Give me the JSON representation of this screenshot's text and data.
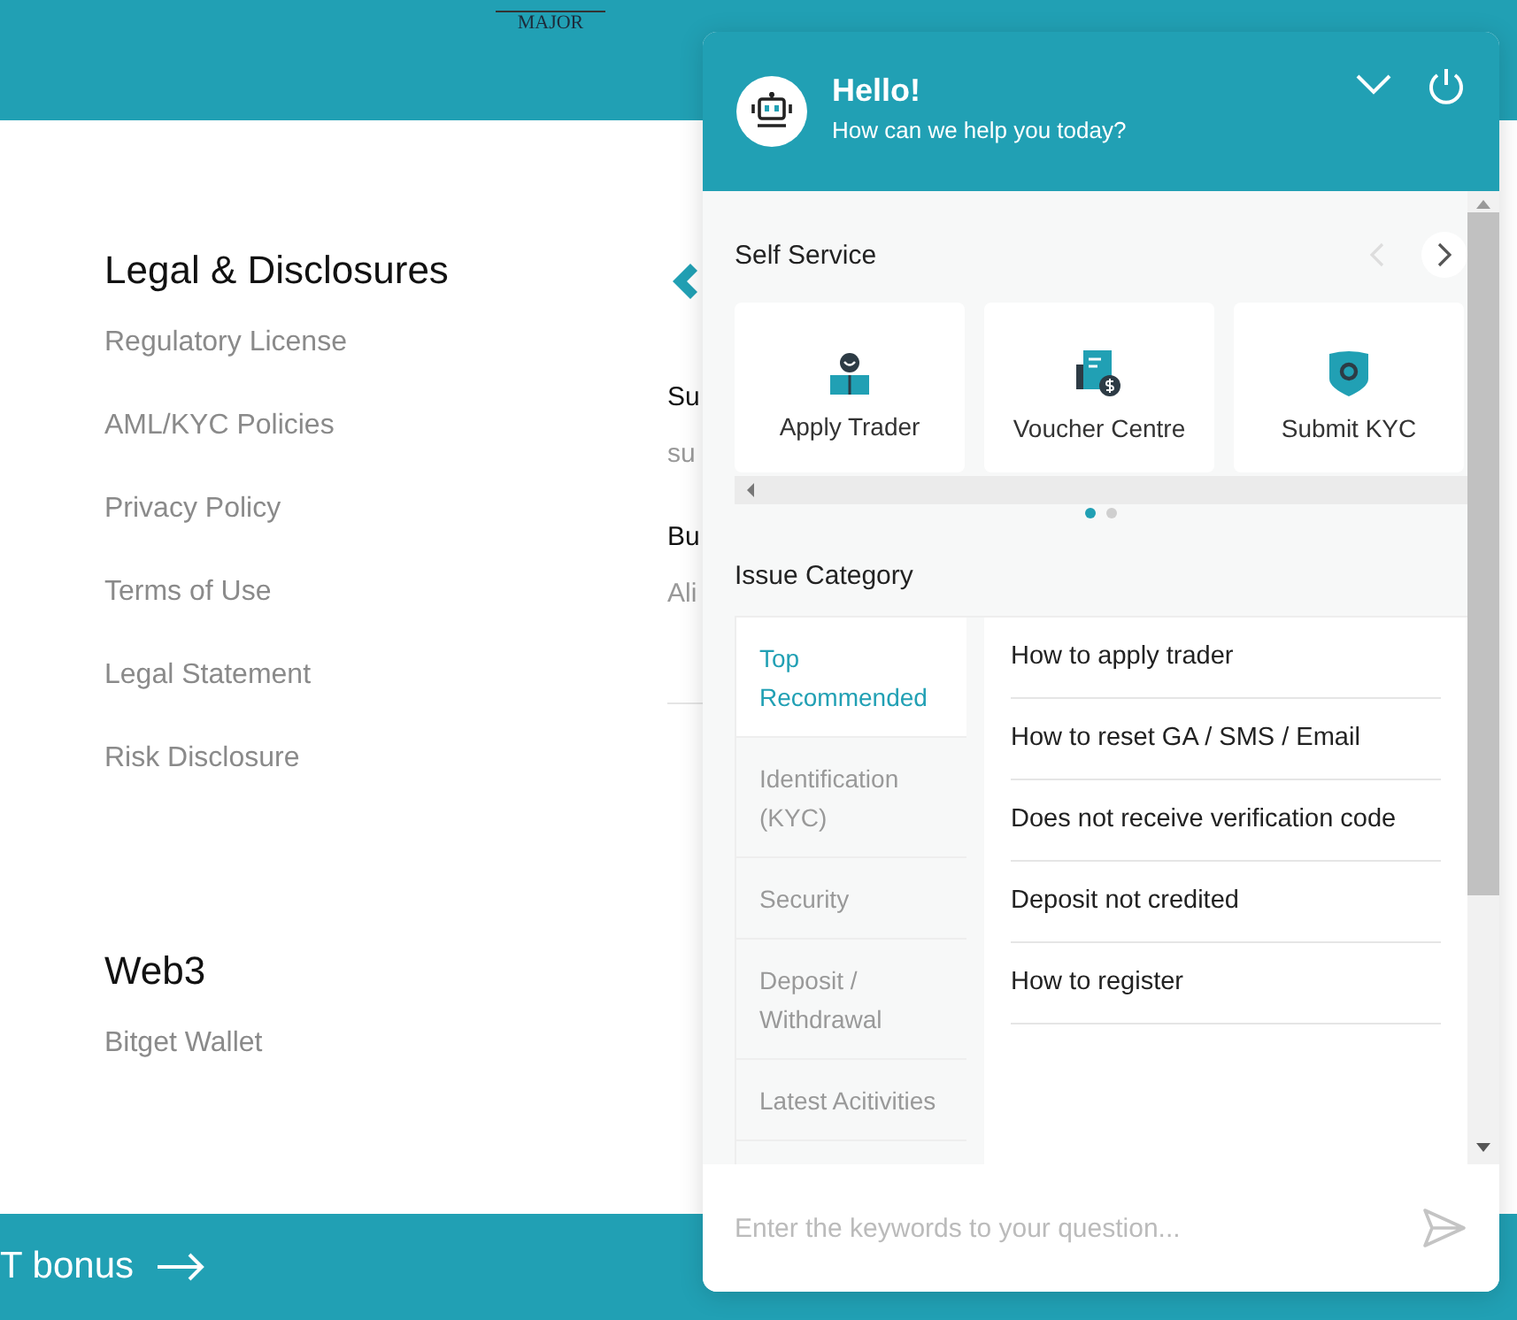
{
  "site_header": {
    "logo_text": "MAJOR"
  },
  "footer_sections": [
    {
      "title": "Legal & Disclosures",
      "links": [
        "Regulatory License",
        "AML/KYC Policies",
        "Privacy Policy",
        "Terms of Use",
        "Legal Statement",
        "Risk Disclosure"
      ]
    },
    {
      "title": "Web3",
      "links": [
        "Bitget Wallet"
      ]
    }
  ],
  "partial_column": [
    {
      "kind": "heading",
      "text": "Su"
    },
    {
      "kind": "value",
      "text": "su"
    },
    {
      "kind": "heading",
      "text": "Bu"
    },
    {
      "kind": "value",
      "text": "Ali"
    }
  ],
  "bottom_banner": {
    "text": "T bonus"
  },
  "chat": {
    "title": "Hello!",
    "subtitle": "How can we help you today?",
    "self_service": {
      "title": "Self Service",
      "prev_disabled": true,
      "next_disabled": false,
      "cards": [
        {
          "kind": "trader",
          "label": "Apply Trader"
        },
        {
          "kind": "voucher",
          "label": "Voucher Centre"
        },
        {
          "kind": "kyc",
          "label": "Submit KYC"
        }
      ],
      "pages": [
        {
          "selected": true
        },
        {
          "selected": false
        }
      ]
    },
    "issue_category": {
      "title": "Issue Category",
      "tabs": [
        {
          "label": "Top Recommended",
          "selected": true
        },
        {
          "label": "Identification (KYC)",
          "selected": false
        },
        {
          "label": "Security",
          "selected": false
        },
        {
          "label": "Deposit / Withdrawal",
          "selected": false
        },
        {
          "label": "Latest Acitivities",
          "selected": false
        }
      ],
      "questions": [
        "How to apply trader",
        "How to reset GA / SMS / Email",
        "Does not receive verification code",
        "Deposit not credited",
        "How to register"
      ]
    },
    "search": {
      "placeholder": "Enter the keywords to your question..."
    }
  }
}
